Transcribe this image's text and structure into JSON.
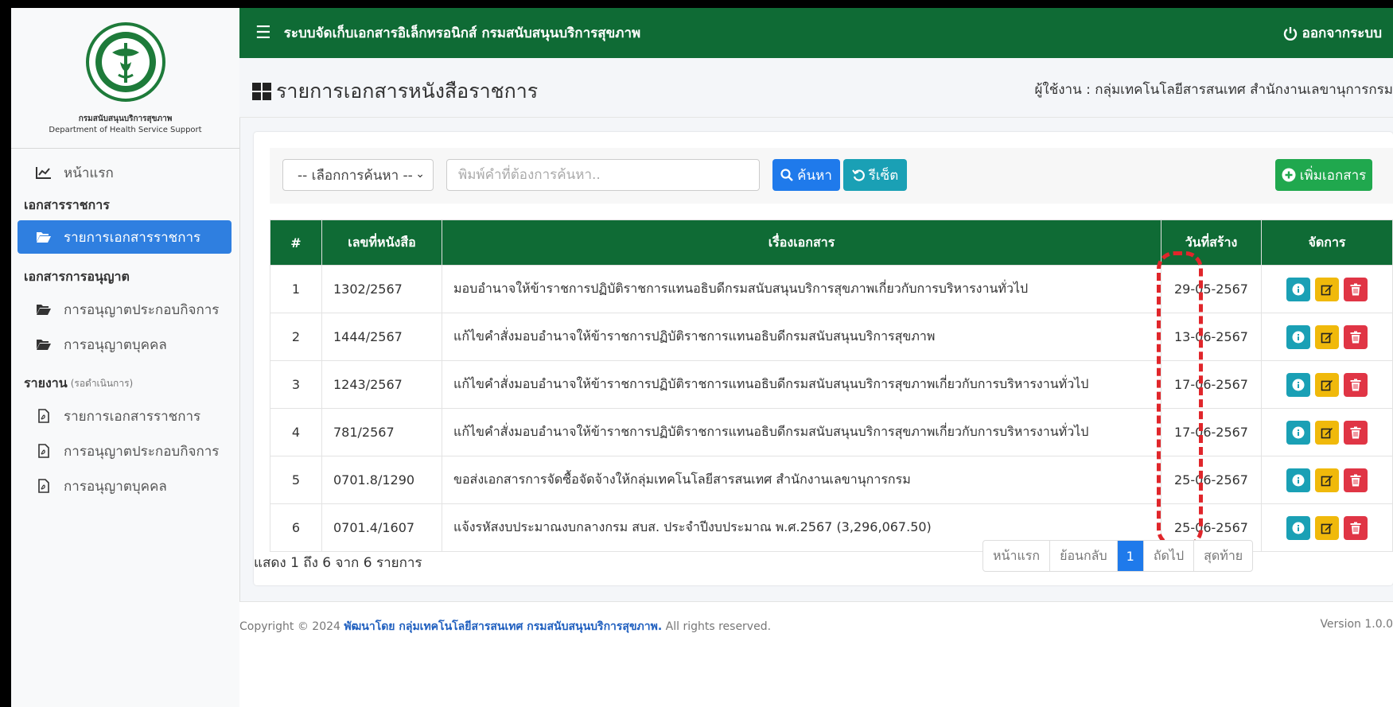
{
  "header": {
    "title": "ระบบจัดเก็บเอกสารอิเล็กทรอนิกส์ กรมสนับสนุนบริการสุขภาพ",
    "logout": "ออกจากระบบ"
  },
  "brand": {
    "name_th": "กรมสนับสนุนบริการสุขภาพ",
    "name_en": "Department of Health Service Support"
  },
  "sidebar": {
    "home": "หน้าแรก",
    "sections": [
      {
        "title": "เอกสารราชการ",
        "items": [
          "รายการเอกสารราชการ"
        ]
      },
      {
        "title": "เอกสารการอนุญาต",
        "items": [
          "การอนุญาตประกอบกิจการ",
          "การอนุญาตบุคคล"
        ]
      },
      {
        "title": "รายงาน",
        "note": "(รอดำเนินการ)",
        "items": [
          "รายการเอกสารราชการ",
          "การอนุญาตประกอบกิจการ",
          "การอนุญาตบุคคล"
        ]
      }
    ]
  },
  "page": {
    "title": "รายการเอกสารหนังสือราชการ",
    "user_line": "ผู้ใช้งาน : กลุ่มเทคโนโลยีสารสนเทศ สำนักงานเลขานุการกรม"
  },
  "search": {
    "select_value": "-- เลือกการค้นหา --",
    "placeholder": "พิมพ์คำที่ต้องการค้นหา..",
    "search_label": "ค้นหา",
    "reset_label": "รีเซ็ต",
    "add_label": "เพิ่มเอกสาร"
  },
  "table": {
    "headers": [
      "#",
      "เลขที่หนังสือ",
      "เรื่องเอกสาร",
      "วันที่สร้าง",
      "จัดการ"
    ],
    "rows": [
      {
        "no": "1",
        "doc_no": "1302/2567",
        "subject": "มอบอำนาจให้ข้าราชการปฏิบัติราชการแทนอธิบดีกรมสนับสนุนบริการสุขภาพเกี่ยวกับการบริหารงานทั่วไป",
        "date": "29-05-2567"
      },
      {
        "no": "2",
        "doc_no": "1444/2567",
        "subject": "แก้ไขคำสั่งมอบอำนาจให้ข้าราชการปฏิบัติราชการแทนอธิบดีกรมสนับสนุนบริการสุขภาพ",
        "date": "13-06-2567"
      },
      {
        "no": "3",
        "doc_no": "1243/2567",
        "subject": "แก้ไขคำสั่งมอบอำนาจให้ข้าราชการปฏิบัติราชการแทนอธิบดีกรมสนับสนุนบริการสุขภาพเกี่ยวกับการบริหารงานทั่วไป",
        "date": "17-06-2567"
      },
      {
        "no": "4",
        "doc_no": "781/2567",
        "subject": "แก้ไขคำสั่งมอบอำนาจให้ข้าราชการปฏิบัติราชการแทนอธิบดีกรมสนับสนุนบริการสุขภาพเกี่ยวกับการบริหารงานทั่วไป",
        "date": "17-06-2567"
      },
      {
        "no": "5",
        "doc_no": "0701.8/1290",
        "subject": "ขอส่งเอกสารการจัดซื้อจัดจ้างให้กลุ่มเทคโนโลยีสารสนเทศ สำนักงานเลขานุการกรม",
        "date": "25-06-2567"
      },
      {
        "no": "6",
        "doc_no": "0701.4/1607",
        "subject": "แจ้งรหัสงบประมาณงบกลางกรม สบส. ประจำปีงบประมาณ พ.ศ.2567 (3,296,067.50)",
        "date": "25-06-2567"
      }
    ]
  },
  "summary": "แสดง 1 ถึง 6 จาก 6 รายการ",
  "pager": {
    "first": "หน้าแรก",
    "prev": "ย้อนกลับ",
    "current": "1",
    "next": "ถัดไป",
    "last": "สุดท้าย"
  },
  "footer": {
    "prefix": "Copyright © 2024",
    "developer": "พัฒนาโดย กลุ่มเทคโนโลยีสารสนเทศ กรมสนับสนุนบริการสุขภาพ.",
    "suffix": "All rights reserved.",
    "version": "Version 1.0.0"
  },
  "colors": {
    "primary_green": "#0f6b35",
    "blue": "#1f7aeb",
    "teal": "#1aa0b5",
    "yellow": "#f0b90b",
    "red": "#e03545",
    "highlight": "#e0262b"
  }
}
